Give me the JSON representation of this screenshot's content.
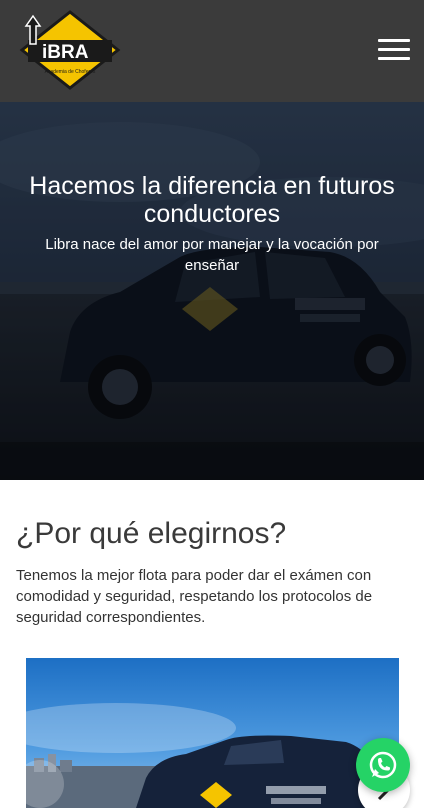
{
  "header": {
    "logo_icon": "libra-logo-icon",
    "logo_text": "iBRA",
    "logo_tagline": "Academia de Choferes",
    "menu_icon": "hamburger-menu-icon"
  },
  "hero": {
    "title": "Hacemos la diferencia en futuros conductores",
    "subtitle": "Libra nace del amor por manejar y la vocación por enseñar"
  },
  "why": {
    "title": "¿Por qué elegirnos?",
    "text": "Tenemos la mejor flota para poder dar el exámen con comodidad y seguridad, respetando los protocolos de seguridad correspondientes."
  },
  "carousel": {
    "prev_icon": "chevron-left-icon",
    "next_icon": "chevron-right-icon"
  },
  "whatsapp": {
    "icon": "whatsapp-icon"
  },
  "colors": {
    "header_bg": "#3b3b3b",
    "logo_yellow": "#f5c400",
    "whatsapp_green": "#25d366"
  }
}
